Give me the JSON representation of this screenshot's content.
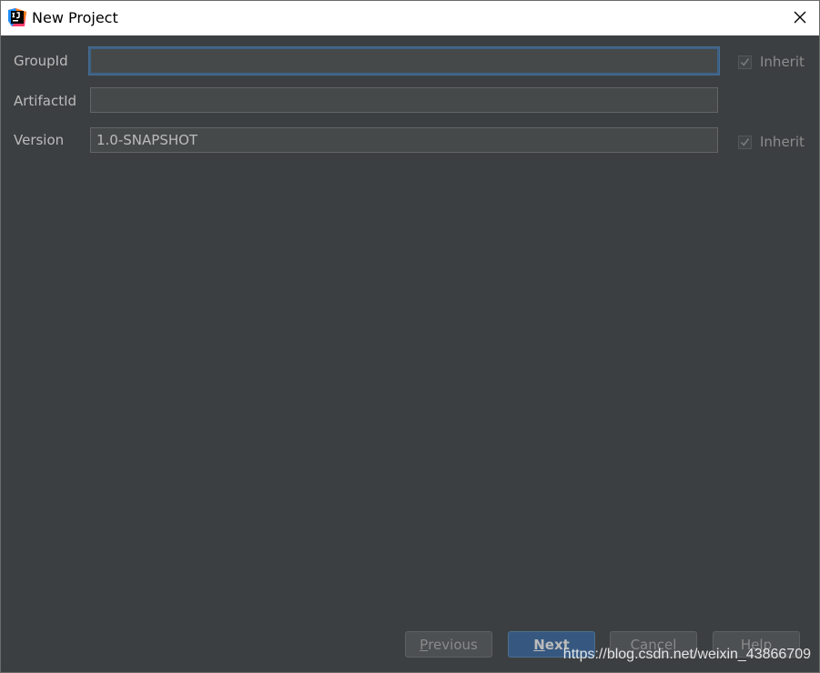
{
  "window": {
    "title": "New Project",
    "app_icon": "intellij-idea-icon",
    "close_icon": "close-icon"
  },
  "form": {
    "group_id": {
      "label": "GroupId",
      "value": "",
      "inherit_label": "Inherit",
      "inherit_checked": true
    },
    "artifact_id": {
      "label": "ArtifactId",
      "value": ""
    },
    "version": {
      "label": "Version",
      "value": "1.0-SNAPSHOT",
      "inherit_label": "Inherit",
      "inherit_checked": true
    }
  },
  "buttons": {
    "previous_mnemonic": "P",
    "previous_rest": "revious",
    "next_mnemonic": "N",
    "next_rest": "ext",
    "cancel": "Cancel",
    "help": "Help"
  },
  "watermark": "https://blog.csdn.net/weixin_43866709",
  "colors": {
    "background": "#3c3f41",
    "field": "#45494a",
    "focus_border": "#3d6185",
    "primary_button": "#365880"
  }
}
